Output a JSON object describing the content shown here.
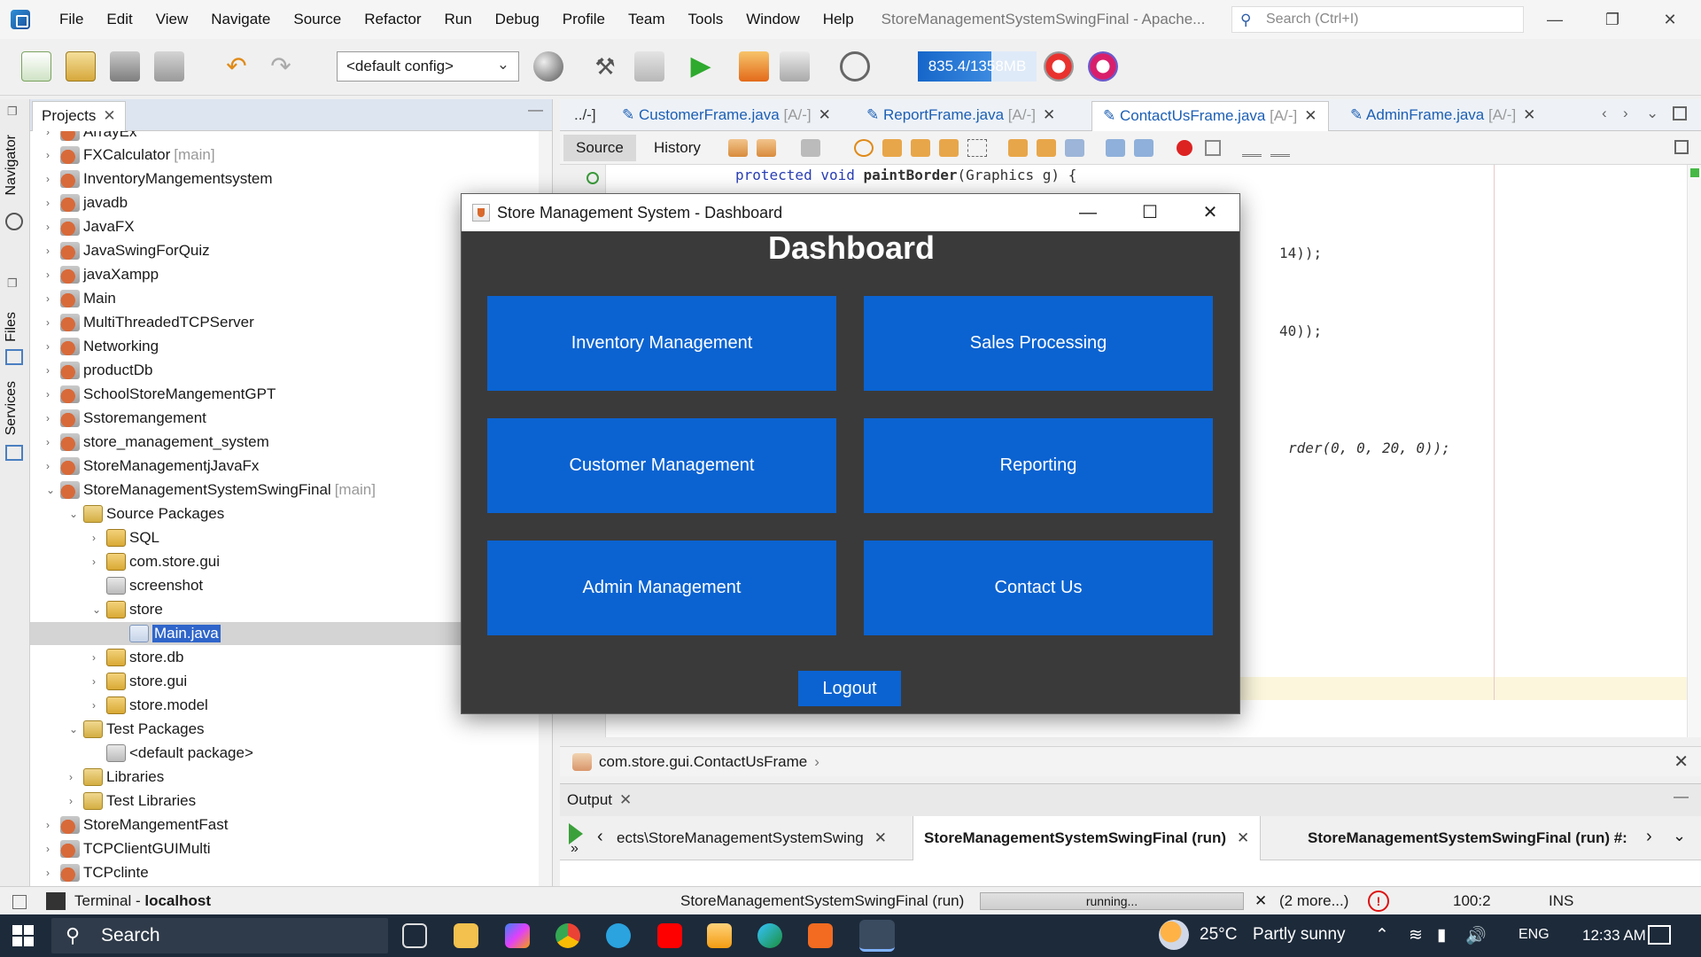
{
  "menubar": {
    "items": [
      "File",
      "Edit",
      "View",
      "Navigate",
      "Source",
      "Refactor",
      "Run",
      "Debug",
      "Profile",
      "Team",
      "Tools",
      "Window",
      "Help"
    ],
    "window_title": "StoreManagementSystemSwingFinal - Apache...",
    "search_placeholder": "Search (Ctrl+I)"
  },
  "toolbar": {
    "config": "<default config>",
    "memory": "835.4/1358MB"
  },
  "projects": {
    "tab_label": "Projects",
    "partial_top": "ArrayEx",
    "rows": [
      {
        "label": "FXCalculator",
        "suffix": "[main]",
        "depth": 0,
        "tog": "›",
        "icon": "proj"
      },
      {
        "label": "InventoryMangementsystem",
        "suffix": "",
        "depth": 0,
        "tog": "›",
        "icon": "proj"
      },
      {
        "label": "javadb",
        "suffix": "",
        "depth": 0,
        "tog": "›",
        "icon": "proj"
      },
      {
        "label": "JavaFX",
        "suffix": "",
        "depth": 0,
        "tog": "›",
        "icon": "proj"
      },
      {
        "label": "JavaSwingForQuiz",
        "suffix": "",
        "depth": 0,
        "tog": "›",
        "icon": "proj"
      },
      {
        "label": "javaXampp",
        "suffix": "",
        "depth": 0,
        "tog": "›",
        "icon": "proj"
      },
      {
        "label": "Main",
        "suffix": "",
        "depth": 0,
        "tog": "›",
        "icon": "proj"
      },
      {
        "label": "MultiThreadedTCPServer",
        "suffix": "",
        "depth": 0,
        "tog": "›",
        "icon": "proj"
      },
      {
        "label": "Networking",
        "suffix": "",
        "depth": 0,
        "tog": "›",
        "icon": "proj"
      },
      {
        "label": "productDb",
        "suffix": "",
        "depth": 0,
        "tog": "›",
        "icon": "proj"
      },
      {
        "label": "SchoolStoreMangementGPT",
        "suffix": "",
        "depth": 0,
        "tog": "›",
        "icon": "proj"
      },
      {
        "label": "Sstoremangement",
        "suffix": "",
        "depth": 0,
        "tog": "›",
        "icon": "proj"
      },
      {
        "label": "store_management_system",
        "suffix": "",
        "depth": 0,
        "tog": "›",
        "icon": "proj"
      },
      {
        "label": "StoreManagementjJavaFx",
        "suffix": "",
        "depth": 0,
        "tog": "›",
        "icon": "proj"
      },
      {
        "label": "StoreManagementSystemSwingFinal",
        "suffix": "[main]",
        "depth": 0,
        "tog": "⌄",
        "icon": "proj"
      },
      {
        "label": "Source Packages",
        "suffix": "",
        "depth": 1,
        "tog": "⌄",
        "icon": "folder"
      },
      {
        "label": "SQL",
        "suffix": "",
        "depth": 2,
        "tog": "›",
        "icon": "pkg"
      },
      {
        "label": "com.store.gui",
        "suffix": "",
        "depth": 2,
        "tog": "›",
        "icon": "pkg"
      },
      {
        "label": "screenshot",
        "suffix": "",
        "depth": 2,
        "tog": "",
        "icon": "lib"
      },
      {
        "label": "store",
        "suffix": "",
        "depth": 2,
        "tog": "⌄",
        "icon": "pkg"
      },
      {
        "label": "Main.java",
        "suffix": "",
        "depth": 3,
        "tog": "",
        "icon": "javafile",
        "selected": true
      },
      {
        "label": "store.db",
        "suffix": "",
        "depth": 2,
        "tog": "›",
        "icon": "pkg"
      },
      {
        "label": "store.gui",
        "suffix": "",
        "depth": 2,
        "tog": "›",
        "icon": "pkg"
      },
      {
        "label": "store.model",
        "suffix": "",
        "depth": 2,
        "tog": "›",
        "icon": "pkg"
      },
      {
        "label": "Test Packages",
        "suffix": "",
        "depth": 1,
        "tog": "⌄",
        "icon": "folder"
      },
      {
        "label": "<default package>",
        "suffix": "",
        "depth": 2,
        "tog": "",
        "icon": "lib"
      },
      {
        "label": "Libraries",
        "suffix": "",
        "depth": 1,
        "tog": "›",
        "icon": "folder"
      },
      {
        "label": "Test Libraries",
        "suffix": "",
        "depth": 1,
        "tog": "›",
        "icon": "folder"
      },
      {
        "label": "StoreMangementFast",
        "suffix": "",
        "depth": 0,
        "tog": "›",
        "icon": "proj"
      },
      {
        "label": "TCPClientGUIMulti",
        "suffix": "",
        "depth": 0,
        "tog": "›",
        "icon": "proj"
      },
      {
        "label": "TCPclinte",
        "suffix": "",
        "depth": 0,
        "tog": "›",
        "icon": "proj"
      }
    ]
  },
  "sidestrip": {
    "navigator": "Navigator",
    "files": "Files",
    "services": "Services"
  },
  "editor": {
    "tabs": [
      {
        "name": "../-]",
        "suffix": ""
      },
      {
        "name": "CustomerFrame.java",
        "suffix": "[A/-]"
      },
      {
        "name": "ReportFrame.java",
        "suffix": "[A/-]"
      },
      {
        "name": "ContactUsFrame.java",
        "suffix": "[A/-]"
      },
      {
        "name": "AdminFrame.java",
        "suffix": "[A/-]"
      }
    ],
    "source_tab": "Source",
    "history_tab": "History",
    "code_line_1_kw": "protected void ",
    "code_line_1_name": "paintBorder",
    "code_line_1_rest": "(Graphics g) {",
    "code_frag_1": "14));",
    "code_frag_2": "40));",
    "code_frag_3": "rder(0, 0, 20, 0));"
  },
  "breadcrumb": {
    "path": "com.store.gui.ContactUsFrame"
  },
  "output": {
    "title": "Output",
    "tabs": [
      {
        "label": "ects\\StoreManagementSystemSwing",
        "active": false
      },
      {
        "label": "StoreManagementSystemSwingFinal (run)",
        "active": true
      },
      {
        "label": "StoreManagementSystemSwingFinal (run) #:",
        "active": false
      }
    ]
  },
  "statusbar": {
    "terminal_label": "Terminal - ",
    "terminal_host": "localhost",
    "run_label": "StoreManagementSystemSwingFinal (run)",
    "progress_text": "running...",
    "more": "(2 more...)",
    "position": "100:2",
    "mode": "INS"
  },
  "dialog": {
    "title": "Store Management System - Dashboard",
    "heading": "Dashboard",
    "buttons": [
      "Inventory Management",
      "Sales Processing",
      "Customer Management",
      "Reporting",
      "Admin Management",
      "Contact Us"
    ],
    "logout": "Logout"
  },
  "taskbar": {
    "search": "Search",
    "weather_temp": "25°C",
    "weather_text": "Partly sunny",
    "lang": "ENG",
    "time": "12:33 AM"
  },
  "colors": {
    "dialog_bg": "#3a3a3a",
    "dashboard_button": "#0b63d1",
    "selection": "#2f65ca"
  }
}
